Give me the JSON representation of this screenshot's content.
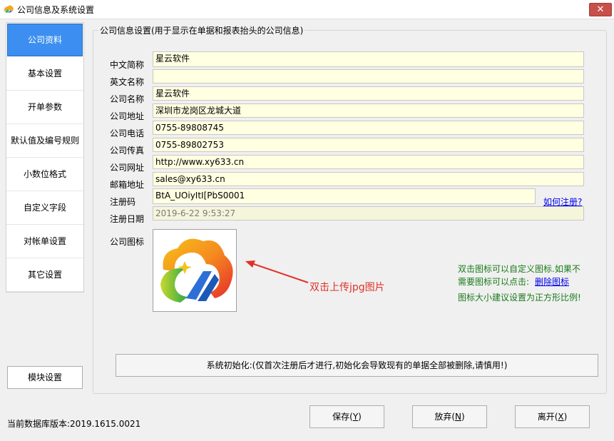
{
  "window": {
    "title": "公司信息及系统设置",
    "close_glyph": "✕"
  },
  "nav": {
    "items": [
      {
        "label": "公司资料",
        "active": true
      },
      {
        "label": "基本设置"
      },
      {
        "label": "开单参数"
      },
      {
        "label": "默认值及编号规则"
      },
      {
        "label": "小数位格式"
      },
      {
        "label": "自定义字段"
      },
      {
        "label": "对帐单设置"
      },
      {
        "label": "其它设置"
      }
    ],
    "module_button": "模块设置",
    "db_version": "当前数据库版本:2019.1615.0021"
  },
  "form": {
    "legend": "公司信息设置(用于显示在单据和报表抬头的公司信息)",
    "fields": [
      {
        "label": "中文简称",
        "value": "星云软件"
      },
      {
        "label": "英文名称",
        "value": ""
      },
      {
        "label": "公司名称",
        "value": "星云软件"
      },
      {
        "label": "公司地址",
        "value": "深圳市龙岗区龙城大道"
      },
      {
        "label": "公司电话",
        "value": "0755-89808745"
      },
      {
        "label": "公司传真",
        "value": "0755-89802753"
      },
      {
        "label": "公司网址",
        "value": "http://www.xy633.cn"
      },
      {
        "label": "邮箱地址",
        "value": "sales@xy633.cn"
      },
      {
        "label": "注册码",
        "value": "BtA_UOiyItI[PbS0001"
      },
      {
        "label": "注册日期",
        "value": "2019-6-22 9:53:27"
      }
    ],
    "register_link": "如何注册?",
    "logo_label": "公司图标",
    "annotation": "双击上传jpg图片",
    "hint_line1": "双击图标可以自定义图标.如果不",
    "hint_line2": "需要图标可以点击:",
    "delete_icon_link": "删除图标",
    "hint_line3": "图标大小建议设置为正方形比例!",
    "init_button": "系统初始化:(仅首次注册后才进行,初始化会导致现有的单据全部被删除,请慎用!)"
  },
  "footer": {
    "save": {
      "text": "保存(",
      "key": "Y",
      "end": ")"
    },
    "discard": {
      "text": "放弃(",
      "key": "N",
      "end": ")"
    },
    "exit": {
      "text": "离开(",
      "key": "X",
      "end": ")"
    }
  },
  "colors": {
    "accent": "#3c8ff0",
    "field_bg": "#ffffe1",
    "hint": "#1a7a1a",
    "annotation": "#e0322b",
    "close": "#c7504a"
  }
}
